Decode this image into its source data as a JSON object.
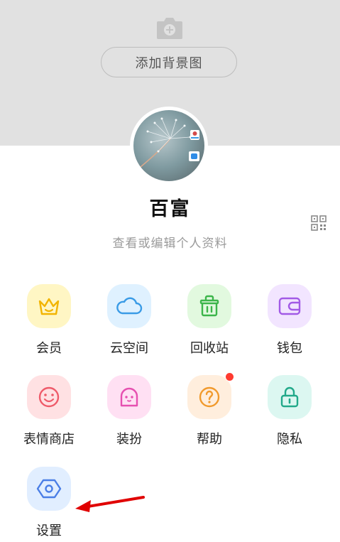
{
  "header": {
    "camera_icon": "camera-plus-icon",
    "add_background_label": "添加背景图"
  },
  "profile": {
    "username": "百富",
    "edit_label": "查看或编辑个人资料",
    "qr_icon": "qr-code-icon"
  },
  "grid": [
    {
      "id": "member",
      "label": "会员",
      "icon": "crown-icon",
      "bg": "#fff6c4",
      "color": "#f2b400",
      "badge": false
    },
    {
      "id": "cloud",
      "label": "云空间",
      "icon": "cloud-icon",
      "bg": "#dff1ff",
      "color": "#3a9be6",
      "badge": false
    },
    {
      "id": "recycle",
      "label": "回收站",
      "icon": "trash-icon",
      "bg": "#e2f9df",
      "color": "#3cb54a",
      "badge": false
    },
    {
      "id": "wallet",
      "label": "钱包",
      "icon": "wallet-icon",
      "bg": "#f2e5ff",
      "color": "#a25ae6",
      "badge": false
    },
    {
      "id": "stickers",
      "label": "表情商店",
      "icon": "smiley-icon",
      "bg": "#ffe1e3",
      "color": "#ef5b6a",
      "badge": false
    },
    {
      "id": "dressup",
      "label": "装扮",
      "icon": "ghost-icon",
      "bg": "#ffe0f3",
      "color": "#e64fb0",
      "badge": false
    },
    {
      "id": "help",
      "label": "帮助",
      "icon": "question-icon",
      "bg": "#ffeedd",
      "color": "#f19a2d",
      "badge": true
    },
    {
      "id": "privacy",
      "label": "隐私",
      "icon": "lock-icon",
      "bg": "#dcf7f1",
      "color": "#22a98a",
      "badge": false
    },
    {
      "id": "settings",
      "label": "设置",
      "icon": "hexagon-settings-icon",
      "bg": "#e1eeff",
      "color": "#4a7ee6",
      "badge": false
    }
  ],
  "annotation": {
    "arrow_color": "#e00000"
  }
}
